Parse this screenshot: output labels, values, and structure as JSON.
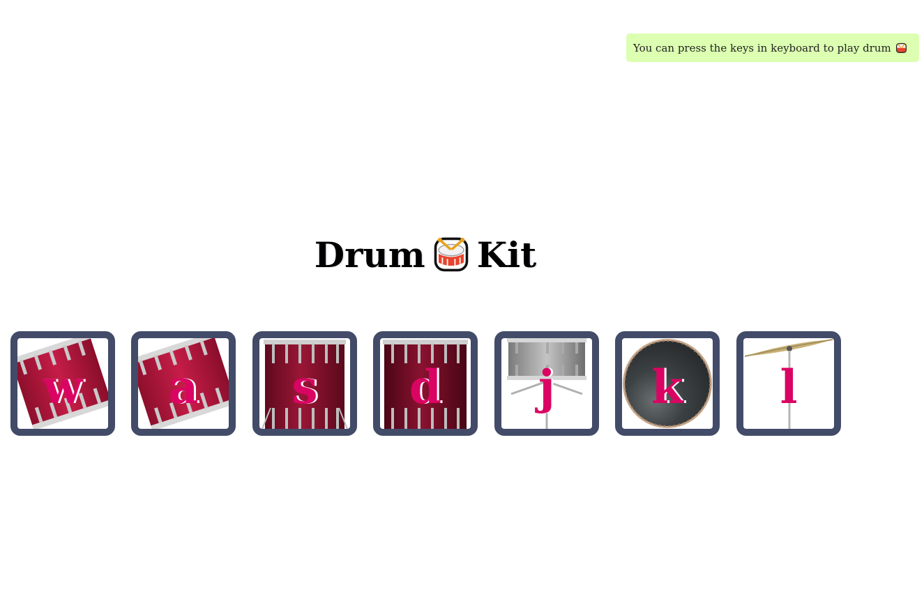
{
  "tip": {
    "text": "You can press the keys in keyboard to play drum",
    "emoji_icon": "drum-emoji-icon"
  },
  "header": {
    "title_left": "Drum",
    "title_right": "Kit",
    "emoji_icon": "drum-emoji-icon"
  },
  "colors": {
    "tile_border": "#424b68",
    "key_letter": "#da0463",
    "tip_background": "#dcffb1"
  },
  "drums": [
    {
      "key": "w",
      "icon": "tilted-tom-drum-icon"
    },
    {
      "key": "a",
      "icon": "tilted-tom-drum-icon"
    },
    {
      "key": "s",
      "icon": "floor-tom-drum-icon"
    },
    {
      "key": "d",
      "icon": "floor-tom-drum-icon"
    },
    {
      "key": "j",
      "icon": "snare-drum-icon"
    },
    {
      "key": "k",
      "icon": "bass-drum-icon"
    },
    {
      "key": "l",
      "icon": "cymbal-icon"
    }
  ]
}
